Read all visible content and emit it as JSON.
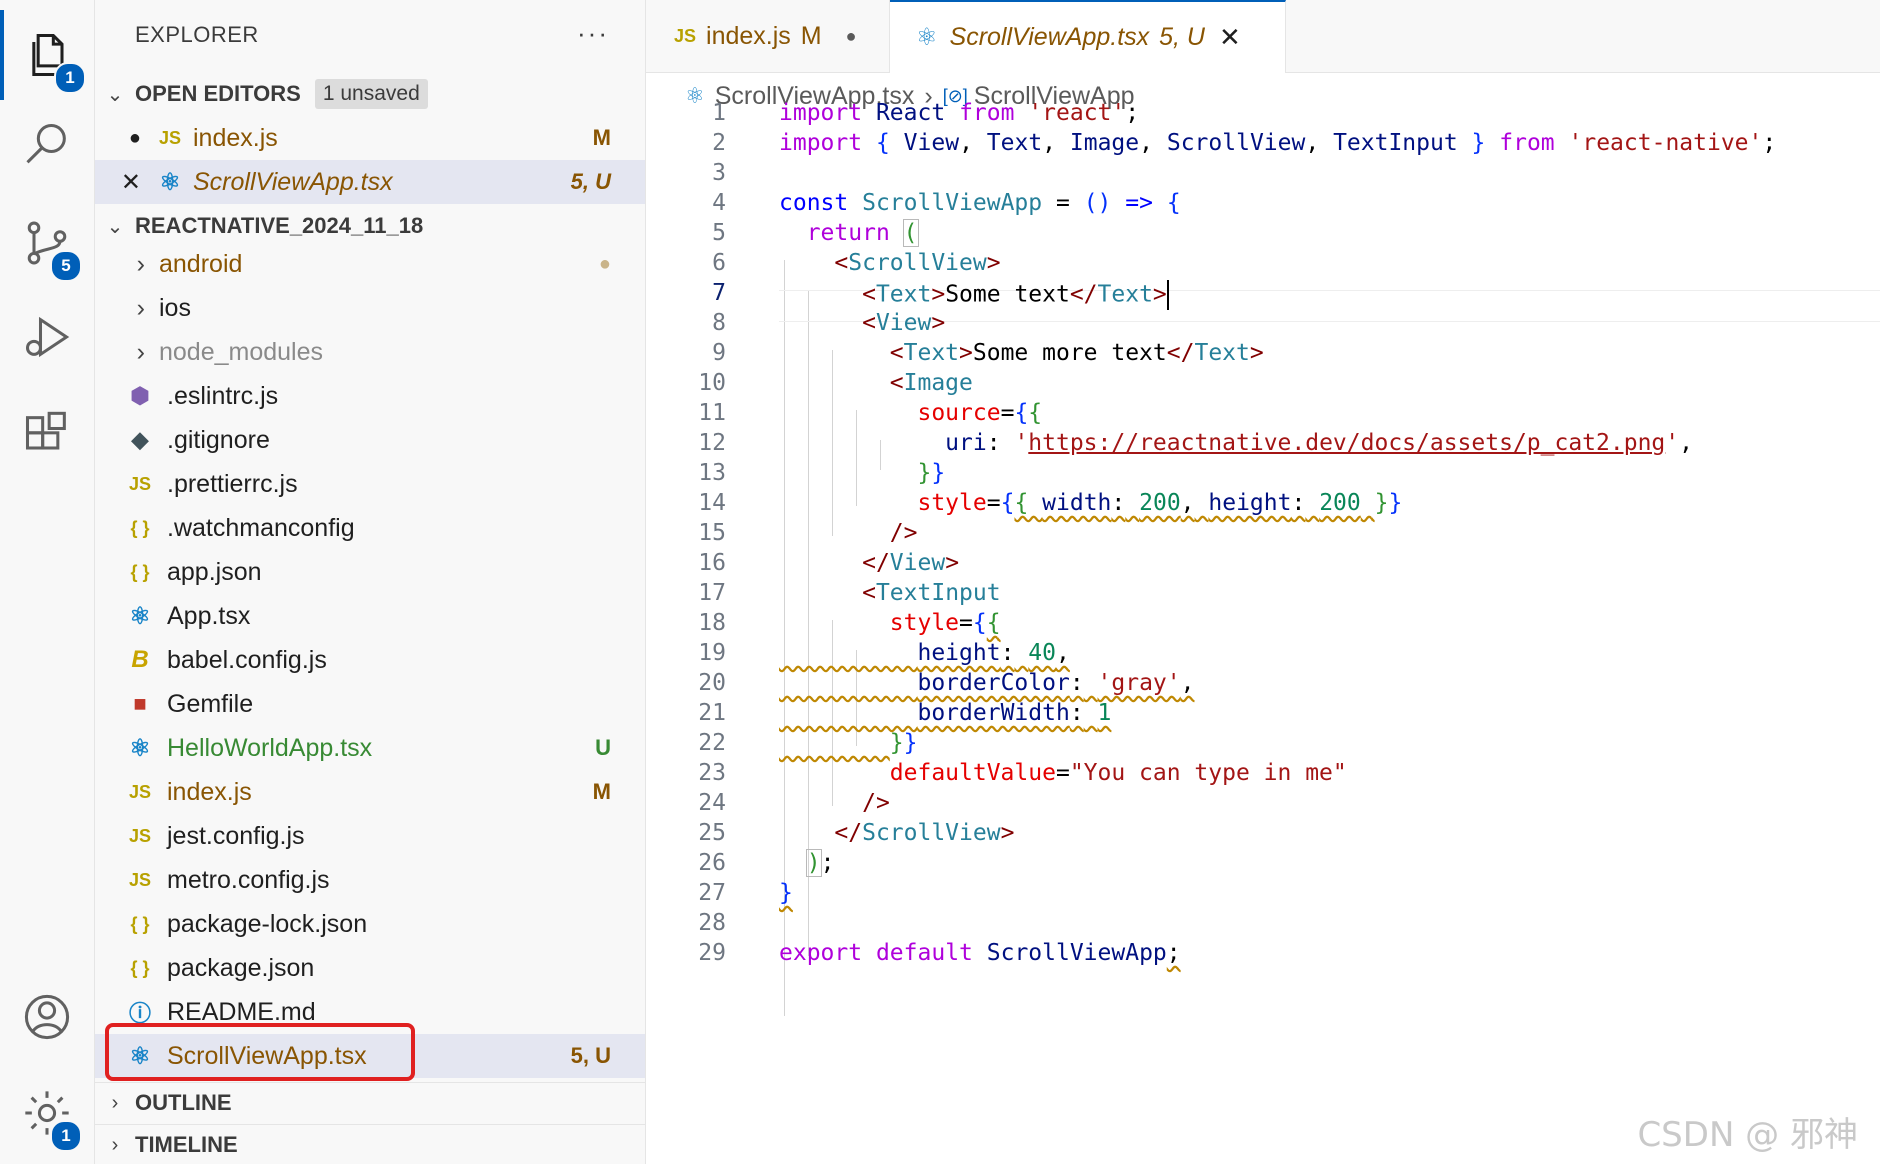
{
  "activity_bar": {
    "explorer_badge": "1",
    "scm_badge": "5",
    "settings_badge": "1"
  },
  "sidebar": {
    "title": "EXPLORER",
    "more": "···",
    "open_editors": {
      "title": "OPEN EDITORS",
      "pill": "1 unsaved",
      "items": [
        {
          "name": "index.js",
          "status": "M"
        },
        {
          "name": "ScrollViewApp.tsx",
          "status": "5, U"
        }
      ]
    },
    "project": {
      "title": "REACTNATIVE_2024_11_18",
      "folders": [
        "android",
        "ios",
        "node_modules"
      ],
      "files": [
        ".eslintrc.js",
        ".gitignore",
        ".prettierrc.js",
        ".watchmanconfig",
        "app.json",
        "App.tsx",
        "babel.config.js",
        "Gemfile",
        "HelloWorldApp.tsx",
        "index.js",
        "jest.config.js",
        "metro.config.js",
        "package-lock.json",
        "package.json",
        "README.md",
        "ScrollViewApp.tsx"
      ],
      "status_u": "U",
      "status_m": "M",
      "status_5u": "5, U"
    },
    "outline": "OUTLINE",
    "timeline": "TIMELINE"
  },
  "tabs": [
    {
      "label": "index.js",
      "status": "M"
    },
    {
      "label": "ScrollViewApp.tsx",
      "status": "5, U"
    }
  ],
  "breadcrumb": {
    "file": "ScrollViewApp.tsx",
    "symbol": "ScrollViewApp"
  },
  "editor": {
    "line_numbers": [
      "1",
      "2",
      "3",
      "4",
      "5",
      "6",
      "7",
      "8",
      "9",
      "10",
      "11",
      "12",
      "13",
      "14",
      "15",
      "16",
      "17",
      "18",
      "19",
      "20",
      "21",
      "22",
      "23",
      "24",
      "25",
      "26",
      "27",
      "28",
      "29"
    ],
    "current_line": "7"
  },
  "watermark": "CSDN @ 邪神",
  "colors": {
    "accent": "#005fb8",
    "modified": "#895503",
    "untracked": "#388a34",
    "highlight_box": "#e02020"
  }
}
